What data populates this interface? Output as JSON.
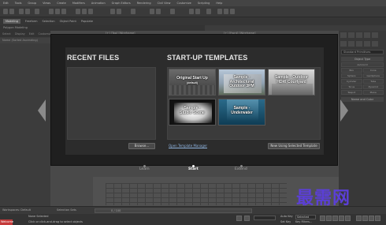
{
  "menubar": {
    "items": [
      "Edit",
      "Tools",
      "Group",
      "Views",
      "Create",
      "Modifiers",
      "Animation",
      "Graph Editors",
      "Rendering",
      "Civil View",
      "Customize",
      "Scripting",
      "Help"
    ]
  },
  "ribbon": {
    "tabs": [
      "Modeling",
      "Freeform",
      "Selection",
      "Object Paint",
      "Populate"
    ],
    "active_tab": "Modeling",
    "subtab": "Polygon Modeling"
  },
  "scene_explorer": {
    "tabs": [
      "Select",
      "Display",
      "Edit",
      "Customize"
    ],
    "rows": [
      "Name (Sorted Ascending)"
    ]
  },
  "viewports": {
    "top_left": "[+] [Top] [Wireframe]",
    "top_right": "[+] [Front] [Wireframe]"
  },
  "command_panel": {
    "dropdown": "Standard Primitives",
    "section_object_type": "Object Type",
    "autogrid": "AutoGrid",
    "objects": [
      "Box",
      "Cone",
      "Sphere",
      "GeoSphere",
      "Cylinder",
      "Tube",
      "Torus",
      "Pyramid",
      "Teapot",
      "Plane"
    ],
    "section_name_color": "Name and Color"
  },
  "welcome": {
    "recent_title": "RECENT FILES",
    "templates_title": "START-UP TEMPLATES",
    "browse_label": "Browse...",
    "open_template_manager": "Open Template Manager",
    "new_using_template": "New Using Selected Template",
    "templates": [
      {
        "name": "Original Start Up",
        "sub": "(default)"
      },
      {
        "name": "Sample - Architectural Outdoor 3PM",
        "sub": ""
      },
      {
        "name": "Sample - Outdoor HDRI Courtyard",
        "sub": ""
      },
      {
        "name": "Sample - Studio Scene",
        "sub": ""
      },
      {
        "name": "Sample - Underwater",
        "sub": ""
      }
    ],
    "nav": {
      "learn": "Learn",
      "start": "Start",
      "extend": "Extend",
      "active": "Start"
    }
  },
  "timeline": {
    "frame": "0 / 100"
  },
  "status": {
    "workspace": "Workspaces: Default",
    "selection_sets": "Selection Sets",
    "none_selected": "None Selected",
    "hint": "Click or click-and-drag to select objects",
    "tag": "Welcome to M",
    "selected_dropdown": "Selected",
    "autokey": "Auto Key",
    "setkey": "Set Key",
    "key_filters": "Key Filters..."
  },
  "colors": {
    "dialog_bg": "#1f1f1f",
    "panel_bg": "#2c2c2c",
    "link": "#8fb4e0",
    "watermark": "#5b3fd6"
  },
  "watermark": "最需网"
}
